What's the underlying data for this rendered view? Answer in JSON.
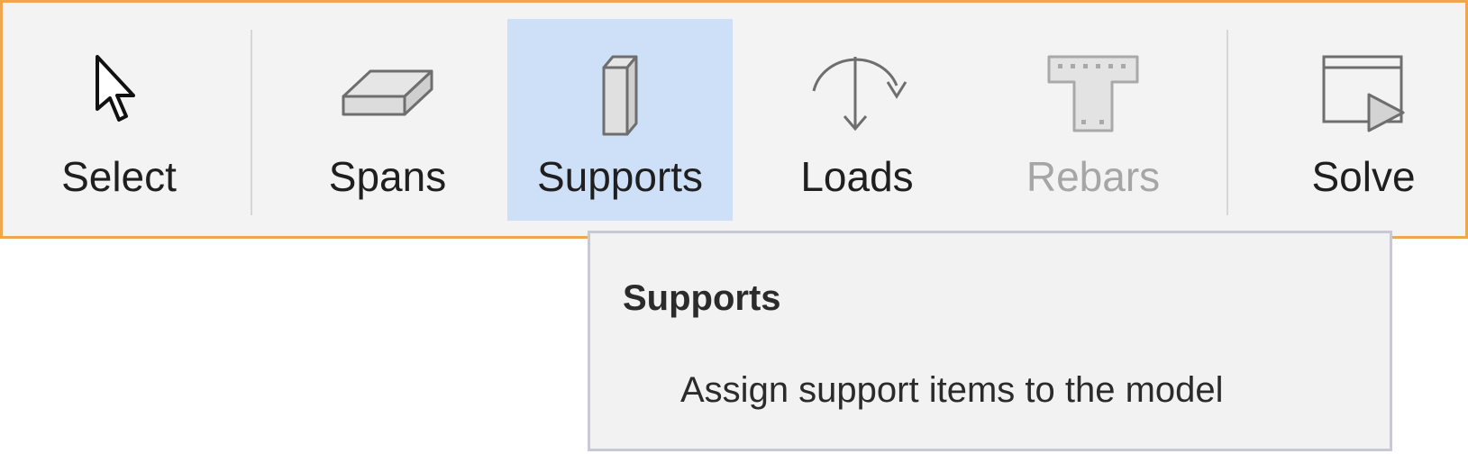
{
  "toolbar": {
    "buttons": [
      {
        "label": "Select",
        "icon": "cursor-arrow-icon",
        "state": "normal"
      },
      {
        "label": "Spans",
        "icon": "slab-icon",
        "state": "normal"
      },
      {
        "label": "Supports",
        "icon": "column-icon",
        "state": "active"
      },
      {
        "label": "Loads",
        "icon": "load-arrow-icon",
        "state": "normal"
      },
      {
        "label": "Rebars",
        "icon": "rebar-section-icon",
        "state": "disabled"
      },
      {
        "label": "Solve",
        "icon": "solve-play-icon",
        "state": "normal"
      }
    ]
  },
  "tooltip": {
    "title": "Supports",
    "description": "Assign support items to the model"
  },
  "colors": {
    "border_accent": "#f0a650",
    "active_background": "#cde0f7",
    "disabled_text": "#a6a6a6"
  }
}
